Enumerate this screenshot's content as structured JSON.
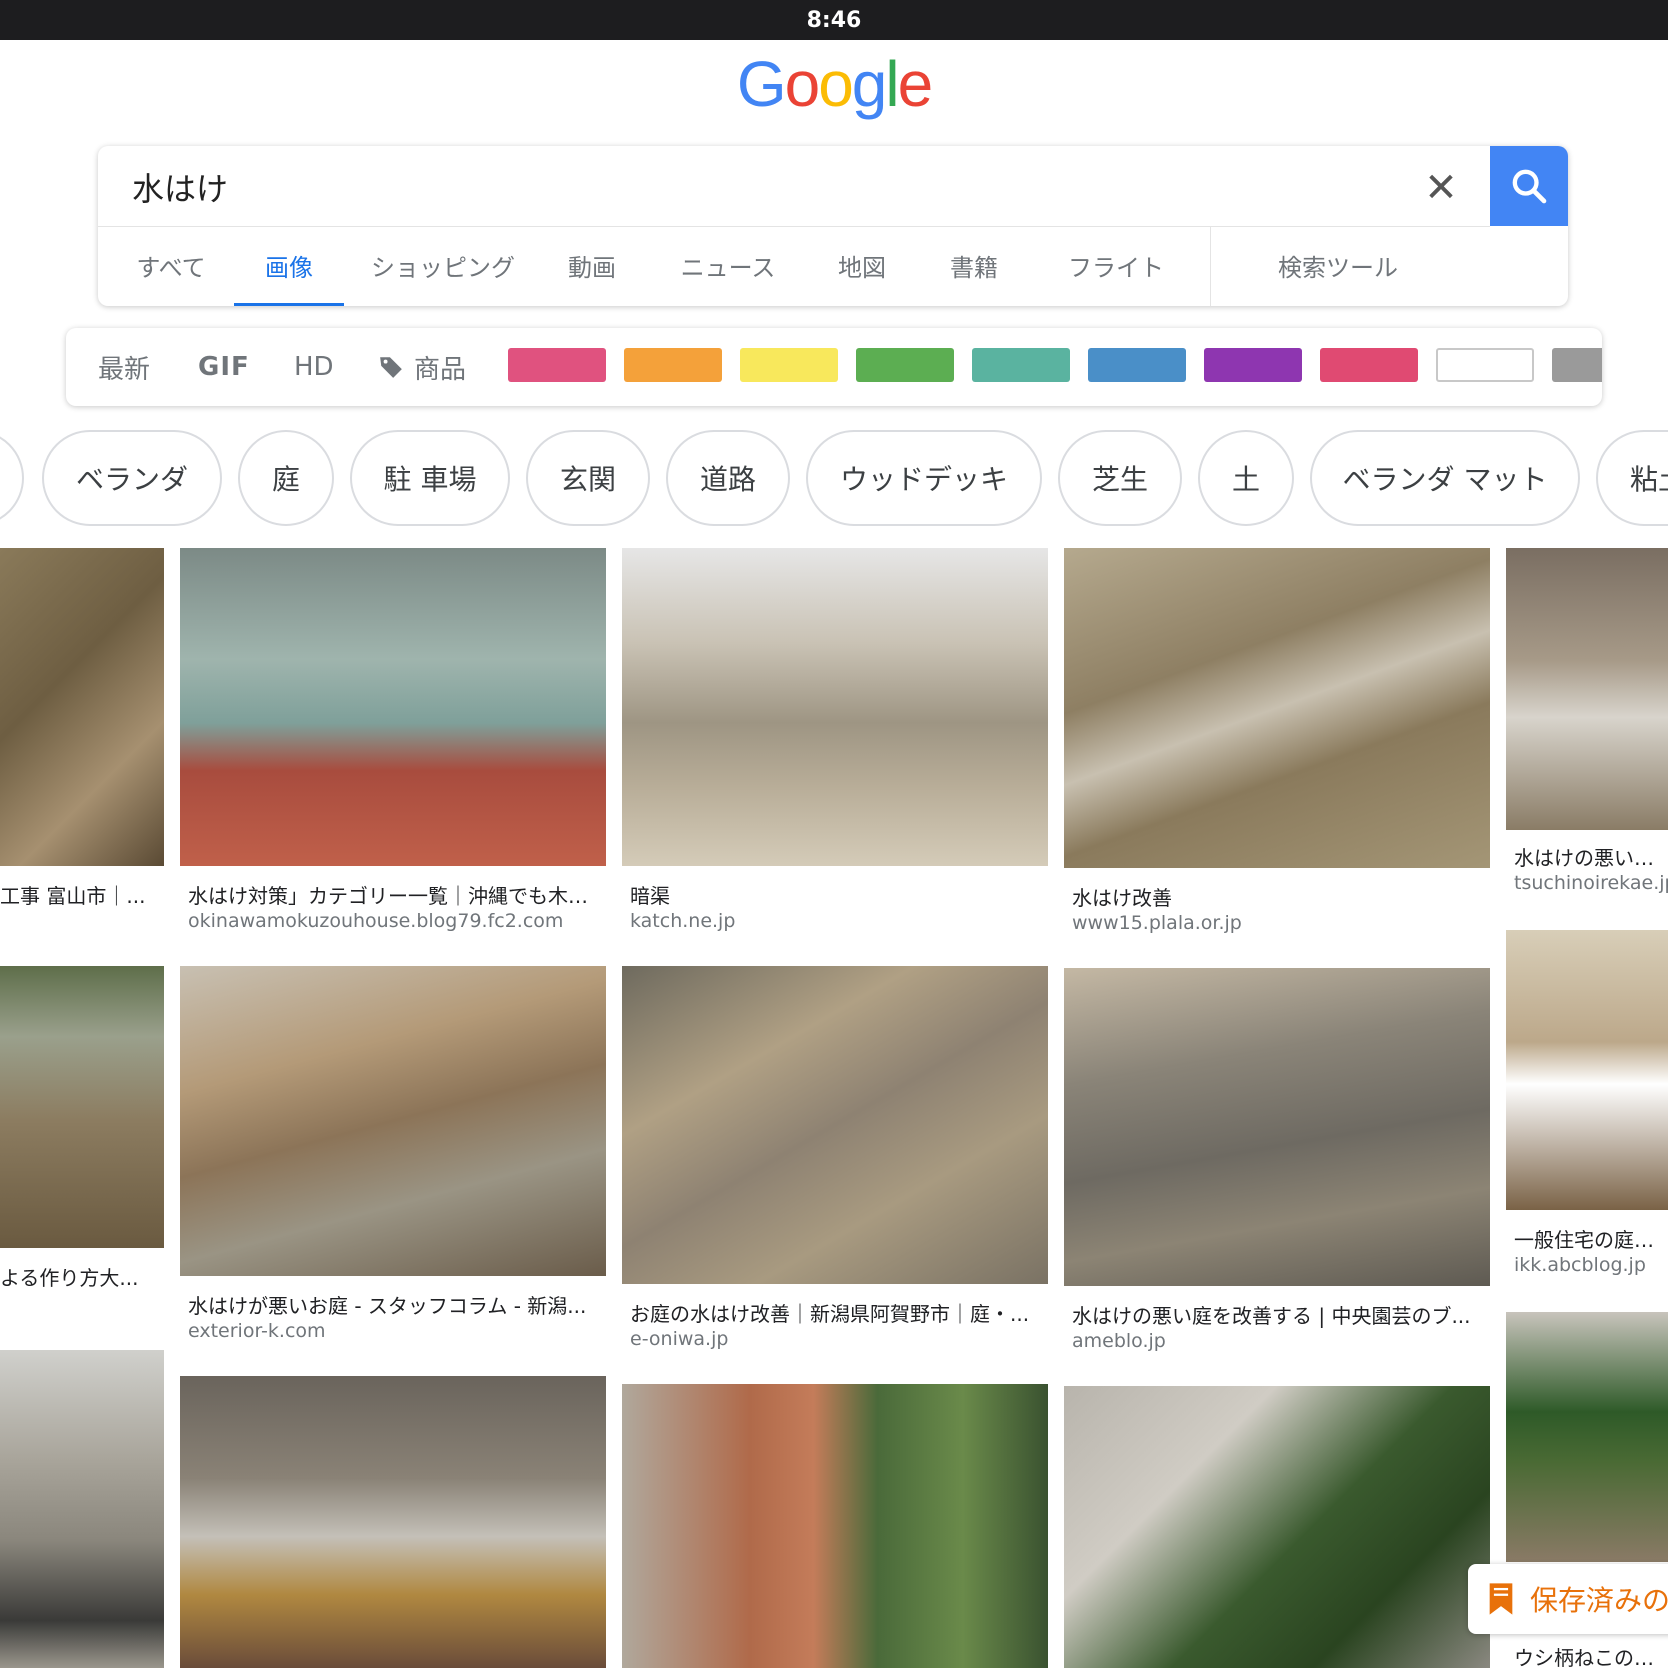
{
  "status_bar": {
    "time": "8:46"
  },
  "logo": {
    "letters": [
      "G",
      "o",
      "o",
      "g",
      "l",
      "e"
    ],
    "colors": [
      "#4285f4",
      "#ea4335",
      "#fbbc05",
      "#4285f4",
      "#34a853",
      "#ea4335"
    ]
  },
  "search": {
    "query": "水はけ"
  },
  "tabs": [
    {
      "label": "すべて"
    },
    {
      "label": "画像"
    },
    {
      "label": "ショッピング"
    },
    {
      "label": "動画"
    },
    {
      "label": "ニュース"
    },
    {
      "label": "地図"
    },
    {
      "label": "書籍"
    },
    {
      "label": "フライト"
    },
    {
      "label": "検索ツール"
    }
  ],
  "active_tab": "画像",
  "filters": {
    "latest": "最新",
    "gif": "GIF",
    "hd": "HD",
    "product": "商品",
    "color_swatches": [
      "#e0527f",
      "#f4a13a",
      "#f8e85c",
      "#5cae52",
      "#5ab3a0",
      "#4a8fc8",
      "#8e36b0",
      "#e04a72",
      "#ffffff",
      "#9a9a9a"
    ]
  },
  "chips": [
    "ベランダ",
    "庭",
    "駐 車場",
    "玄関",
    "道路",
    "ウッドデッキ",
    "芝生",
    "土",
    "ベランダ マット",
    "粘土"
  ],
  "results": [
    {
      "title": "工事 富山市｜...",
      "source": ""
    },
    {
      "title": "水はけ対策」カテゴリー一覧｜沖縄でも木造...",
      "source": "okinawamokuzouhouse.blog79.fc2.com"
    },
    {
      "title": "暗渠",
      "source": "katch.ne.jp"
    },
    {
      "title": "水はけ改善",
      "source": "www15.plala.or.jp"
    },
    {
      "title": "水はけの悪い土ヤ",
      "source": "tsuchinoirekae.jp"
    },
    {
      "title": "よる作り方大...",
      "source": ""
    },
    {
      "title": "水はけが悪いお庭 - スタッフコラム - 新潟...",
      "source": "exterior-k.com"
    },
    {
      "title": "お庭の水はけ改善｜新潟県阿賀野市｜庭・...",
      "source": "e-oniwa.jp"
    },
    {
      "title": "水はけの悪い庭を改善する | 中央園芸のブ...",
      "source": "ameblo.jp"
    },
    {
      "title": "一般住宅の庭や家",
      "source": "ikk.abcblog.jp"
    },
    {
      "title": "ウシ柄ねこのブロ",
      "source": ""
    }
  ],
  "saved": {
    "label": "保存済みの"
  }
}
